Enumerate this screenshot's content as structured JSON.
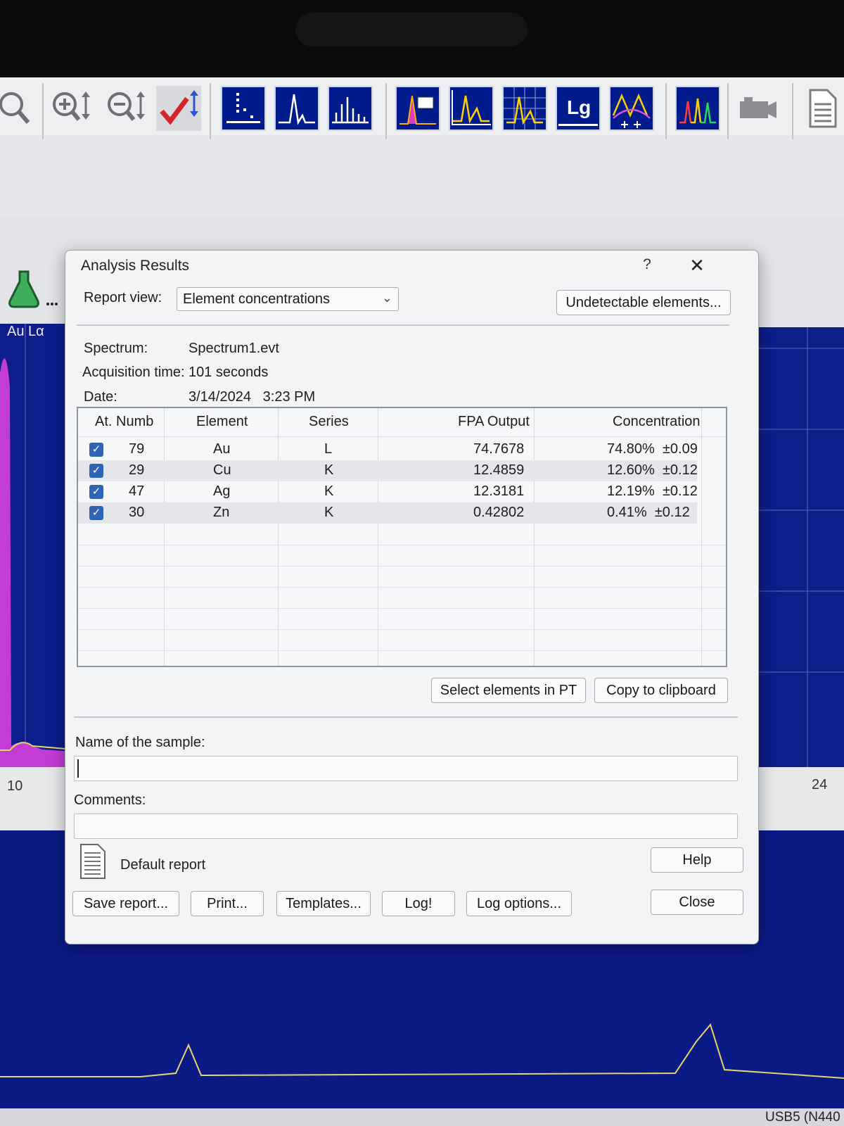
{
  "toolbar": {
    "buttons": [
      "zoom-fit-icon",
      "zoom-in-vertical-icon",
      "zoom-out-vertical-icon",
      "check-scale-icon",
      "line-markers-icon",
      "single-peak-icon",
      "multi-peak-icon",
      "peak-label-icon",
      "spectrum-grid-icon",
      "full-grid-icon",
      "log-scale-icon",
      "overlap-icon",
      "multi-spectrum-icon",
      "camera-icon",
      "report-icon"
    ],
    "log_label": "Lg"
  },
  "spectrum": {
    "peak_label": "Au Lα",
    "axis_left": "10",
    "axis_right": "24",
    "status": "USB5 (N440"
  },
  "dialog": {
    "title": "Analysis Results",
    "help_label": "?",
    "close_label": "✕",
    "report_view_label": "Report view:",
    "report_view_value": "Element concentrations",
    "undetectable_button": "Undetectable elements...",
    "spectrum_label": "Spectrum:",
    "spectrum_value": "Spectrum1.evt",
    "acq_label": "Acquisition time:",
    "acq_value": "101 seconds",
    "date_label": "Date:",
    "date_value": "3/14/2024   3:23 PM",
    "table": {
      "headers": [
        "At. Numb",
        "Element",
        "Series",
        "FPA Output",
        "Concentration"
      ],
      "rows": [
        {
          "checked": true,
          "at_numb": "79",
          "element": "Au",
          "series": "L",
          "fpa": "74.7678",
          "conc": "74.80%  ±0.09"
        },
        {
          "checked": true,
          "at_numb": "29",
          "element": "Cu",
          "series": "K",
          "fpa": "12.4859",
          "conc": "12.60%  ±0.12"
        },
        {
          "checked": true,
          "at_numb": "47",
          "element": "Ag",
          "series": "K",
          "fpa": "12.3181",
          "conc": "12.19%  ±0.12"
        },
        {
          "checked": true,
          "at_numb": "30",
          "element": "Zn",
          "series": "K",
          "fpa": "0.42802",
          "conc": "0.41%  ±0.12"
        }
      ]
    },
    "select_pt_button": "Select elements in PT",
    "copy_button": "Copy to clipboard",
    "sample_name_label": "Name of the sample:",
    "sample_name_value": "",
    "comments_label": "Comments:",
    "comments_value": "",
    "default_report_label": "Default report",
    "help_button": "Help",
    "save_report_button": "Save report...",
    "print_button": "Print...",
    "templates_button": "Templates...",
    "log_button": "Log!",
    "log_options_button": "Log options...",
    "close_button": "Close"
  },
  "colors": {
    "spectrum_bg": "#0d1d8a",
    "peak_fill": "#c43cd6",
    "trace": "#e3d66a",
    "checkbox": "#2f64b5"
  }
}
